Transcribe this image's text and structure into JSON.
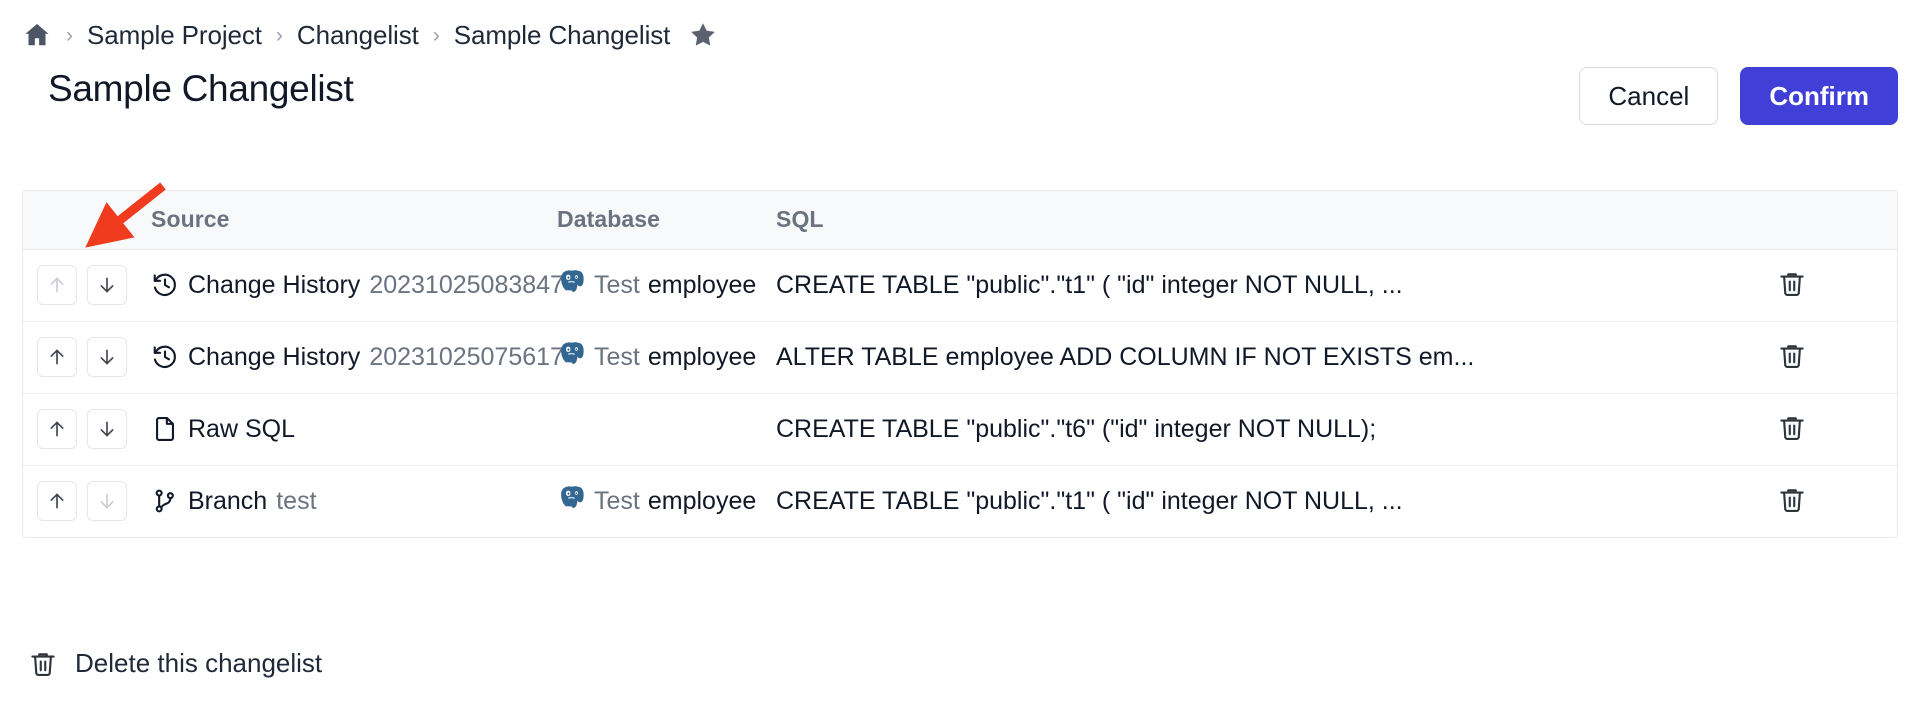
{
  "breadcrumb": {
    "home_icon": "home-icon",
    "separator": "›",
    "items": [
      {
        "label": "Sample Project"
      },
      {
        "label": "Changelist"
      },
      {
        "label": "Sample Changelist"
      }
    ],
    "star_icon": "star-icon"
  },
  "header": {
    "title": "Sample Changelist",
    "cancel_label": "Cancel",
    "confirm_label": "Confirm",
    "confirm_color": "#4040d9"
  },
  "table": {
    "columns": [
      "",
      "Source",
      "Database",
      "SQL",
      ""
    ],
    "rows": [
      {
        "move_up_icon": "arrow-up-icon",
        "move_down_icon": "arrow-down-icon",
        "move_up_enabled": false,
        "move_down_enabled": true,
        "source_icon": "history-icon",
        "source_label": "Change History",
        "source_sub": "20231025083847",
        "db_icon": "postgresql-icon",
        "db_env": "Test",
        "db_name": "employee",
        "sql": "CREATE TABLE  \"public\".\"t1\" (    \"id\" integer NOT NULL,    ...",
        "delete_icon": "trash-icon"
      },
      {
        "move_up_icon": "arrow-up-icon",
        "move_down_icon": "arrow-down-icon",
        "move_up_enabled": true,
        "move_down_enabled": true,
        "source_icon": "history-icon",
        "source_label": "Change History",
        "source_sub": "20231025075617",
        "db_icon": "postgresql-icon",
        "db_env": "Test",
        "db_name": "employee",
        "sql": "ALTER TABLE employee ADD COLUMN IF NOT EXISTS em...",
        "delete_icon": "trash-icon"
      },
      {
        "move_up_icon": "arrow-up-icon",
        "move_down_icon": "arrow-down-icon",
        "move_up_enabled": true,
        "move_down_enabled": true,
        "source_icon": "file-icon",
        "source_label": "Raw SQL",
        "source_sub": "",
        "db_icon": "",
        "db_env": "",
        "db_name": "",
        "sql": "CREATE TABLE  \"public\".\"t6\" (\"id\" integer NOT NULL);",
        "delete_icon": "trash-icon"
      },
      {
        "move_up_icon": "arrow-up-icon",
        "move_down_icon": "arrow-down-icon",
        "move_up_enabled": true,
        "move_down_enabled": false,
        "source_icon": "branch-icon",
        "source_label": "Branch",
        "source_sub": "test",
        "db_icon": "postgresql-icon",
        "db_env": "Test",
        "db_name": "employee",
        "sql": "CREATE TABLE \"public\".\"t1\" (    \"id\" integer NOT NULL,    ...",
        "delete_icon": "trash-icon"
      }
    ]
  },
  "footer": {
    "delete_icon": "trash-icon",
    "delete_label": "Delete this changelist"
  },
  "annotation": {
    "arrow_color": "#f03b1e",
    "arrow_name": "red-pointer-arrow"
  }
}
